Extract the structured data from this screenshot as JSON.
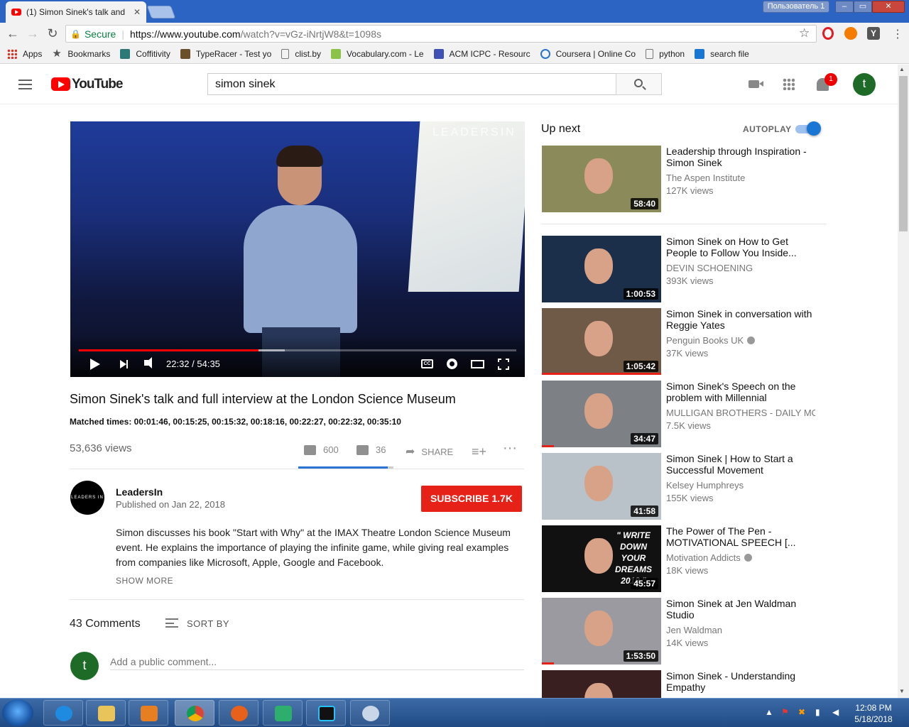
{
  "browser": {
    "tab_title": "(1) Simon Sinek's talk and",
    "user": "Пользователь 1",
    "secure_label": "Secure",
    "url_host": "https://www.youtube.com",
    "url_path": "/watch?v=vGz-iNrtjW8&t=1098s"
  },
  "bookmarks": [
    {
      "label": "Apps",
      "color": "#d93025"
    },
    {
      "label": "Bookmarks",
      "color": "#555555"
    },
    {
      "label": "Coffitivity",
      "color": "#2b7a78"
    },
    {
      "label": "TypeRacer - Test yo",
      "color": "#6b4f2a"
    },
    {
      "label": "clist.by",
      "color": "#777777"
    },
    {
      "label": "Vocabulary.com - Le",
      "color": "#8bc34a"
    },
    {
      "label": "ACM ICPC - Resourc",
      "color": "#3f51b5"
    },
    {
      "label": "Coursera | Online Co",
      "color": "#2a73cc"
    },
    {
      "label": "python",
      "color": "#777777"
    },
    {
      "label": "search file",
      "color": "#1976d2"
    }
  ],
  "youtube": {
    "logo_text": "YouTube",
    "search_value": "simon sinek",
    "notifications": "1",
    "avatar_letter": "t"
  },
  "player": {
    "watermark": "LEADERSIN",
    "time": "22:32 / 54:35",
    "progress": 0.41,
    "buffered": 0.47,
    "cc": "CC"
  },
  "video": {
    "title": "Simon Sinek's talk and full interview at the London Science Museum",
    "matched_times": "Matched times: 00:01:46, 00:15:25, 00:15:32, 00:18:16, 00:22:27, 00:22:32, 00:35:10",
    "views": "53,636 views",
    "likes": "600",
    "dislikes": "36",
    "share": "SHARE",
    "like_ratio": 0.943
  },
  "channel": {
    "name": "LeadersIn",
    "avatar_text": "LEADERS IN",
    "published": "Published on Jan 22, 2018",
    "subscribe": "SUBSCRIBE  1.7K",
    "description": "Simon discusses his book \"Start with Why\" at the IMAX Theatre London Science Museum event. He explains the importance of playing the infinite game, while giving real examples from companies like Microsoft, Apple, Google and Facebook.",
    "show_more": "SHOW MORE"
  },
  "comments": {
    "count": "43 Comments",
    "sort": "SORT BY",
    "avatar_letter": "t",
    "placeholder": "Add a public comment..."
  },
  "sidebar": {
    "up_next": "Up next",
    "autoplay": "AUTOPLAY",
    "items": [
      {
        "title": "Leadership through Inspiration - Simon Sinek",
        "channel": "The Aspen Institute",
        "views": "127K views",
        "duration": "58:40",
        "bg": "#8b8a5a",
        "watched": 0
      },
      {
        "title": "Simon Sinek on How to Get People to Follow You Inside...",
        "channel": "DEVIN SCHOENING",
        "views": "393K views",
        "duration": "1:00:53",
        "bg": "#1c2f4a",
        "watched": 0
      },
      {
        "title": "Simon Sinek in conversation with Reggie Yates",
        "channel": "Penguin Books UK",
        "views": "37K views",
        "duration": "1:05:42",
        "bg": "#6e5a46",
        "watched": 1
      },
      {
        "title": "Simon Sinek's Speech on the problem with Millennial",
        "channel": "MULLIGAN BROTHERS - DAILY MOT",
        "views": "7.5K views",
        "duration": "34:47",
        "bg": "#7d8085",
        "watched": 0.1
      },
      {
        "title": "Simon Sinek | How to Start a Successful Movement",
        "channel": "Kelsey Humphreys",
        "views": "155K views",
        "duration": "41:58",
        "bg": "#b9c2c8",
        "watched": 0
      },
      {
        "title": "The Power of The Pen - MOTIVATIONAL SPEECH [...",
        "channel": "Motivation Addicts",
        "views": "18K views",
        "duration": "45:57",
        "bg": "#111111",
        "watched": 0,
        "overlay": "\" WRITE DOWN YOUR DREAMS 2018 \""
      },
      {
        "title": "Simon Sinek at Jen Waldman Studio",
        "channel": "Jen Waldman",
        "views": "14K views",
        "duration": "1:53:50",
        "bg": "#9a9aa0",
        "watched": 0.1
      },
      {
        "title": "Simon Sinek - Understanding Empathy",
        "channel": "",
        "views": "",
        "duration": "",
        "bg": "#3a1f20",
        "watched": 0
      }
    ]
  },
  "taskbar": {
    "time": "12:08 PM",
    "date": "5/18/2018"
  }
}
